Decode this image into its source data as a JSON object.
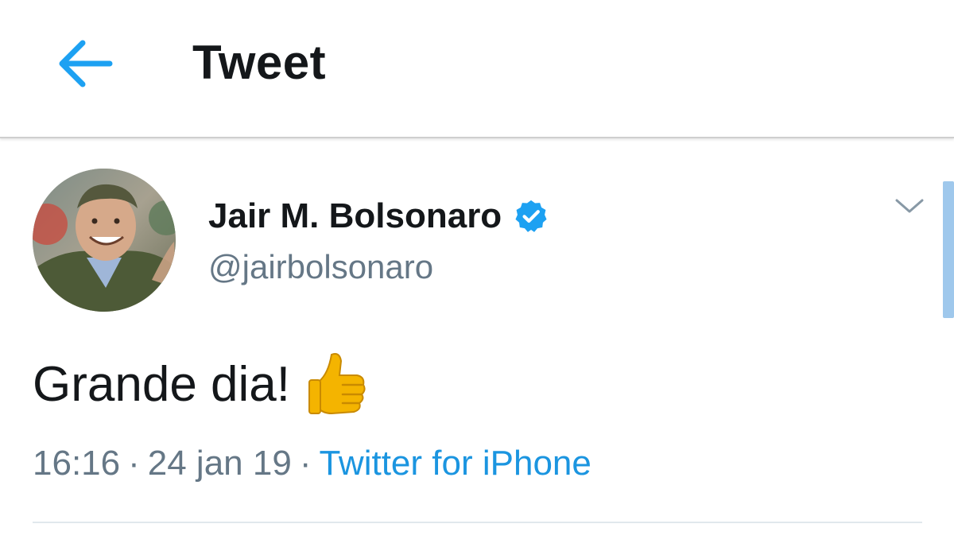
{
  "header": {
    "back_icon": "arrow-left-icon",
    "title": "Tweet"
  },
  "tweet": {
    "avatar_alt": "",
    "display_name": "Jair M. Bolsonaro",
    "verified_icon": "verified-badge-icon",
    "handle": "@jairbolsonaro",
    "menu_icon": "chevron-down-icon",
    "text": "Grande dia!",
    "emoji_icon": "thumbs-up-icon",
    "time": "16:16",
    "separator": "·",
    "date": "24 jan 19",
    "source": "Twitter for iPhone"
  },
  "colors": {
    "accent": "#1da1f2",
    "link": "#1b95e0",
    "text_primary": "#14171a",
    "text_secondary": "#657786",
    "divider": "#e1e8ed"
  }
}
